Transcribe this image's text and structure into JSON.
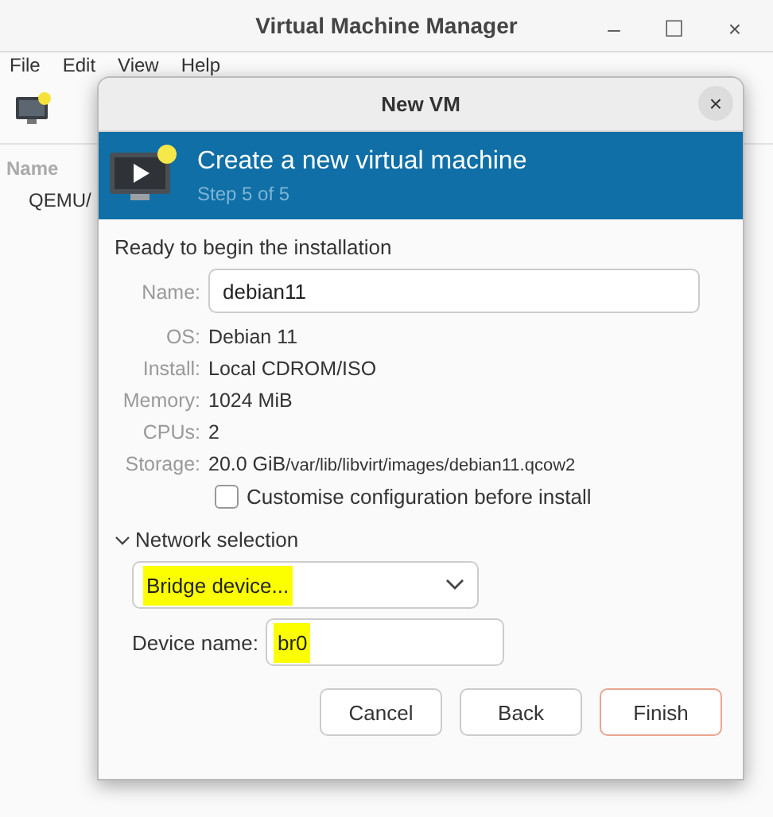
{
  "window": {
    "title": "Virtual Machine Manager",
    "controls": [
      "–",
      "☐",
      "×"
    ]
  },
  "menu": [
    "File",
    "Edit",
    "View",
    "Help"
  ],
  "list": {
    "header": "Name",
    "rows": [
      "QEMU/"
    ]
  },
  "dialog": {
    "title": "New VM",
    "close": "×",
    "banner": {
      "title": "Create a new virtual machine",
      "subtitle": "Step 5 of 5"
    },
    "heading": "Ready to begin the installation",
    "name": {
      "label": "Name:",
      "value": "debian11"
    },
    "details": [
      {
        "label": "OS:",
        "value": "Debian 11"
      },
      {
        "label": "Install:",
        "value": "Local CDROM/ISO"
      },
      {
        "label": "Memory:",
        "value": "1024 MiB"
      },
      {
        "label": "CPUs:",
        "value": "2"
      },
      {
        "label": "Storage:",
        "value": "20.0 GiB",
        "extra": "/var/lib/libvirt/images/debian11.qcow2"
      }
    ],
    "customise": {
      "label": "Customise configuration before install",
      "checked": false
    },
    "network": {
      "label": "Network selection",
      "expanded": true,
      "source": {
        "value": "Bridge device...",
        "highlighted": true
      },
      "device": {
        "label": "Device name:",
        "value": "br0",
        "highlighted": true
      }
    },
    "buttons": [
      {
        "label": "Cancel",
        "default": false
      },
      {
        "label": "Back",
        "default": false
      },
      {
        "label": "Finish",
        "default": true
      }
    ]
  }
}
